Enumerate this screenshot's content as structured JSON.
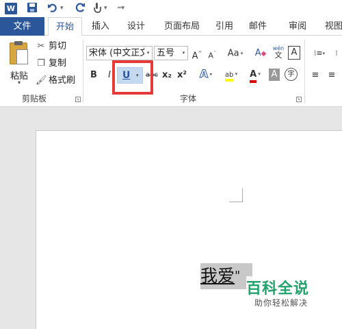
{
  "qat": {
    "app_logo": "W",
    "icons": [
      "save-icon",
      "undo-icon",
      "redo-icon",
      "touch-mode-icon",
      "customize-qat-icon"
    ]
  },
  "tabs": {
    "file": "文件",
    "items": [
      "开始",
      "插入",
      "设计",
      "页面布局",
      "引用",
      "邮件",
      "审阅",
      "视图"
    ],
    "active": "开始"
  },
  "clipboard": {
    "paste": "粘贴",
    "cut": "剪切",
    "copy": "复制",
    "format_painter": "格式刷",
    "group_label": "剪贴板"
  },
  "font": {
    "family": "宋体 (中文正文)",
    "size": "五号",
    "grow": "A",
    "shrink": "A",
    "change_case": "Aa",
    "clear": "A",
    "phonetic": "wén",
    "border_char": "A",
    "bold": "B",
    "italic": "I",
    "underline": "U",
    "strike": "abc",
    "subscript": "x₂",
    "superscript": "x²",
    "effects": "A",
    "highlight": "ab",
    "font_color": "A",
    "shading": "A",
    "enclose": "字",
    "group_label": "字体",
    "highlight_color": "#ffff00",
    "font_color_value": "#e00000"
  },
  "document": {
    "selected_text": "我爱",
    "trailing_text": "\""
  },
  "watermark": {
    "title": "百科全说",
    "subtitle": "助你轻松解决"
  },
  "colors": {
    "accent": "#2b579a",
    "highlight_frame": "#e63a3a"
  }
}
